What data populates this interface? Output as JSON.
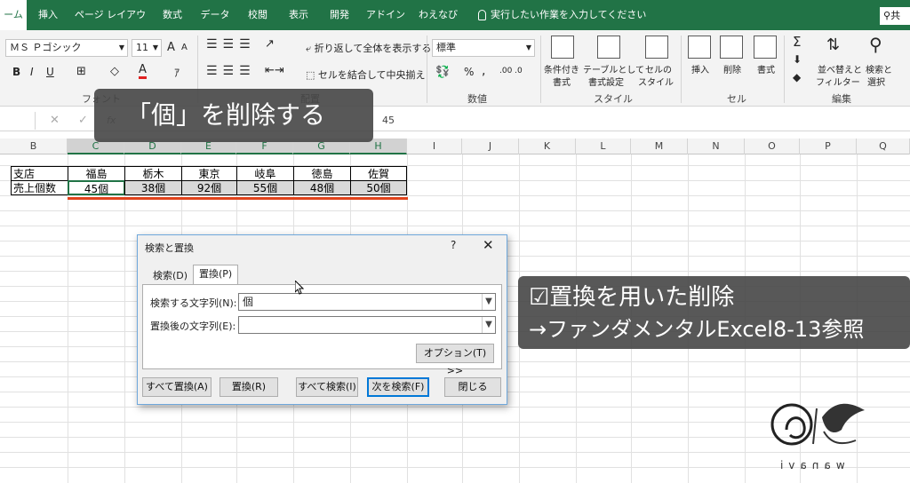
{
  "ribbon_tabs": [
    "ーム",
    "挿入",
    "ページ レイアウト",
    "数式",
    "データ",
    "校閲",
    "表示",
    "開発",
    "アドイン",
    "わえなび"
  ],
  "tellme": "実行したい作業を入力してください",
  "share": "共",
  "font_group": {
    "font_name": "ＭＳ Ｐゴシック",
    "font_size": "11",
    "grow": "A",
    "shrink": "A",
    "bold": "B",
    "italic": "I",
    "underline": "U",
    "color_a": "A",
    "label": "フォント"
  },
  "align_group": {
    "wrap": "折り返して全体を表示する",
    "merge": "セルを結合して中央揃え",
    "label": "配置"
  },
  "number_group": {
    "format": "標準",
    "percent": "%",
    "comma": ",",
    "label": "数値"
  },
  "style_group": {
    "cond": "条件付き\n書式",
    "cond1": "条件付き",
    "cond2": "書式",
    "table1": "テーブルとして",
    "table2": "書式設定",
    "cell1": "セルの",
    "cell2": "スタイル",
    "label": "スタイル"
  },
  "cells_group": {
    "insert": "挿入",
    "delete": "削除",
    "format": "書式",
    "label": "セル"
  },
  "edit_group": {
    "sigma": "Σ",
    "sort1": "並べ替えと",
    "sort2": "フィルター",
    "find1": "検索と",
    "find2": "選択",
    "label": "編集"
  },
  "formula_bar": {
    "fx": "fx",
    "value": "45"
  },
  "columns": [
    "B",
    "C",
    "D",
    "E",
    "F",
    "G",
    "H",
    "I",
    "J",
    "K",
    "L",
    "M",
    "N",
    "O",
    "P",
    "Q"
  ],
  "table": {
    "header_label": "支店",
    "row_label": "売上個数",
    "branches": [
      "福島",
      "栃木",
      "東京",
      "岐阜",
      "徳島",
      "佐賀"
    ],
    "values": [
      "45個",
      "38個",
      "92個",
      "55個",
      "48個",
      "50個"
    ]
  },
  "callout1": "「個」を削除する",
  "callout2": {
    "line1": "☑置換を用いた削除",
    "line2": "→ファンダメンタルExcel8-13参照"
  },
  "dialog": {
    "title": "検索と置換",
    "help": "?",
    "close": "✕",
    "tab_find": "検索(D)",
    "tab_replace": "置換(P)",
    "find_label": "検索する文字列(N):",
    "find_value": "個",
    "replace_label": "置換後の文字列(E):",
    "replace_value": "",
    "options": "オプション(T) >>",
    "btn_replace_all": "すべて置換(A)",
    "btn_replace": "置換(R)",
    "btn_find_all": "すべて検索(I)",
    "btn_find_next": "次を検索(F)",
    "btn_close": "閉じる"
  },
  "logo_text": "wanavi"
}
